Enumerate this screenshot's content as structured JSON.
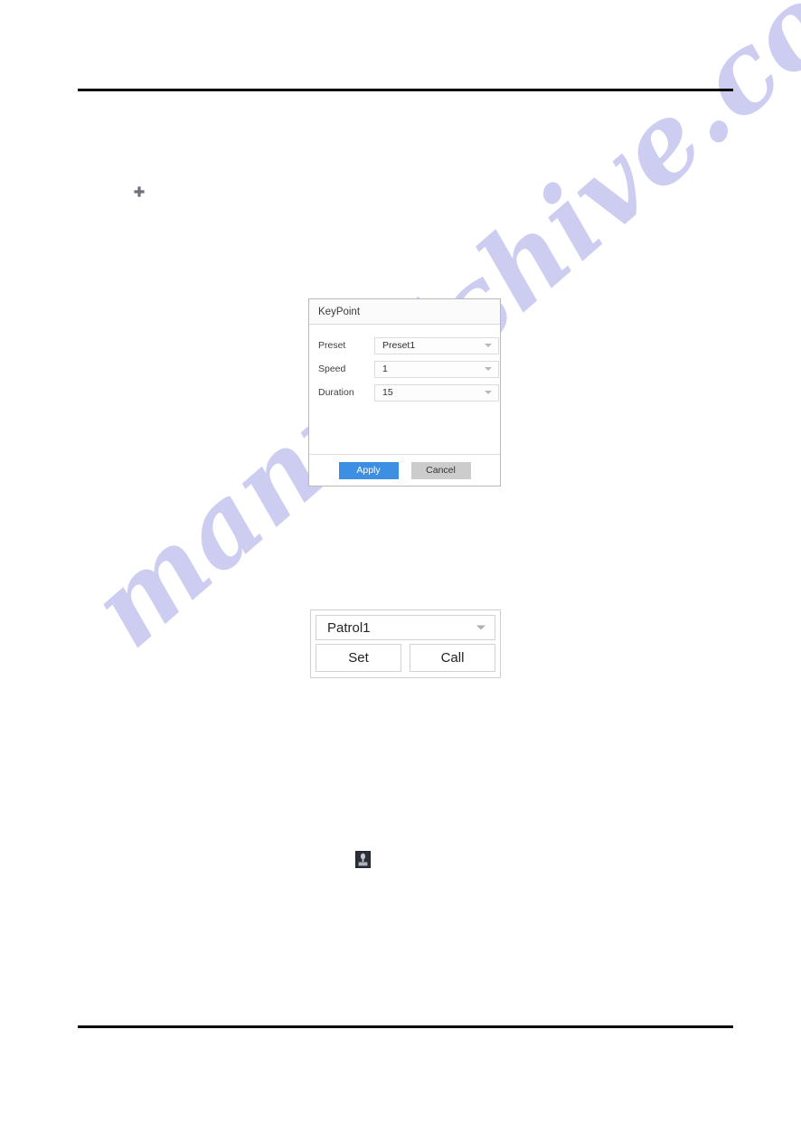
{
  "page": {
    "background_color": "#ffffff",
    "rule_color": "#000000",
    "watermark_text": "manualshive.com",
    "watermark_color": "#cdcdf2"
  },
  "icons": {
    "add_keypoint": {
      "name": "plus-icon",
      "glyph": "+",
      "color": "#6d7278"
    },
    "manual_ptz": {
      "name": "ptz-manual-icon",
      "background": "#2b3039",
      "foreground": "#c3c8cf"
    }
  },
  "keypoint_dialog": {
    "title": "KeyPoint",
    "fields": [
      {
        "label": "Preset",
        "value": "Preset1",
        "name": "preset"
      },
      {
        "label": "Speed",
        "value": "1",
        "name": "speed"
      },
      {
        "label": "Duration",
        "value": "15",
        "name": "duration"
      }
    ],
    "buttons": {
      "apply": "Apply",
      "cancel": "Cancel"
    },
    "accent_color": "#3d8fe4",
    "cancel_color": "#cccccc"
  },
  "patrol_panel": {
    "selected": "Patrol1",
    "buttons": {
      "set": "Set",
      "call": "Call"
    }
  }
}
